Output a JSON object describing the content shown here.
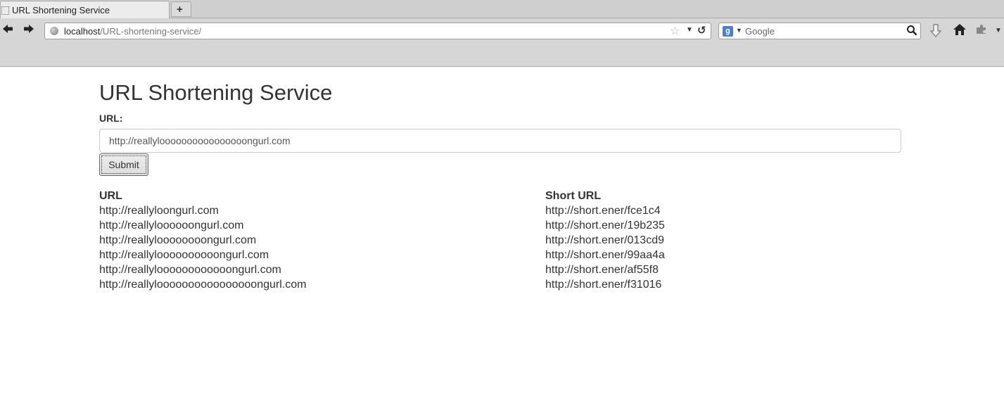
{
  "browser": {
    "tab_title": "URL Shortening Service",
    "new_tab_symbol": "+",
    "url_host": "localhost",
    "url_path": "/URL-shortening-service/",
    "search_placeholder": "Google",
    "search_engine_letter": "g"
  },
  "page": {
    "title": "URL Shortening Service",
    "field_label": "URL:",
    "input_value": "http://reallyloooooooooooooooongurl.com",
    "submit_label": "Submit"
  },
  "table": {
    "col_url_header": "URL",
    "col_short_header": "Short URL",
    "rows": [
      {
        "url": "http://reallyloongurl.com",
        "short": "http://short.ener/fce1c4"
      },
      {
        "url": "http://reallyloooooongurl.com",
        "short": "http://short.ener/19b235"
      },
      {
        "url": "http://reallyloooooooongurl.com",
        "short": "http://short.ener/013cd9"
      },
      {
        "url": "http://reallyloooooooooongurl.com",
        "short": "http://short.ener/99aa4a"
      },
      {
        "url": "http://reallyloooooooooooongurl.com",
        "short": "http://short.ener/af55f8"
      },
      {
        "url": "http://reallyloooooooooooooooongurl.com",
        "short": "http://short.ener/f31016"
      }
    ]
  },
  "icons": {
    "back": "back-arrow-icon",
    "forward": "forward-arrow-icon",
    "bookmark": "star-icon",
    "reload": "reload-icon",
    "download": "download-arrow-icon",
    "home": "home-icon",
    "addon": "puzzle-icon"
  }
}
